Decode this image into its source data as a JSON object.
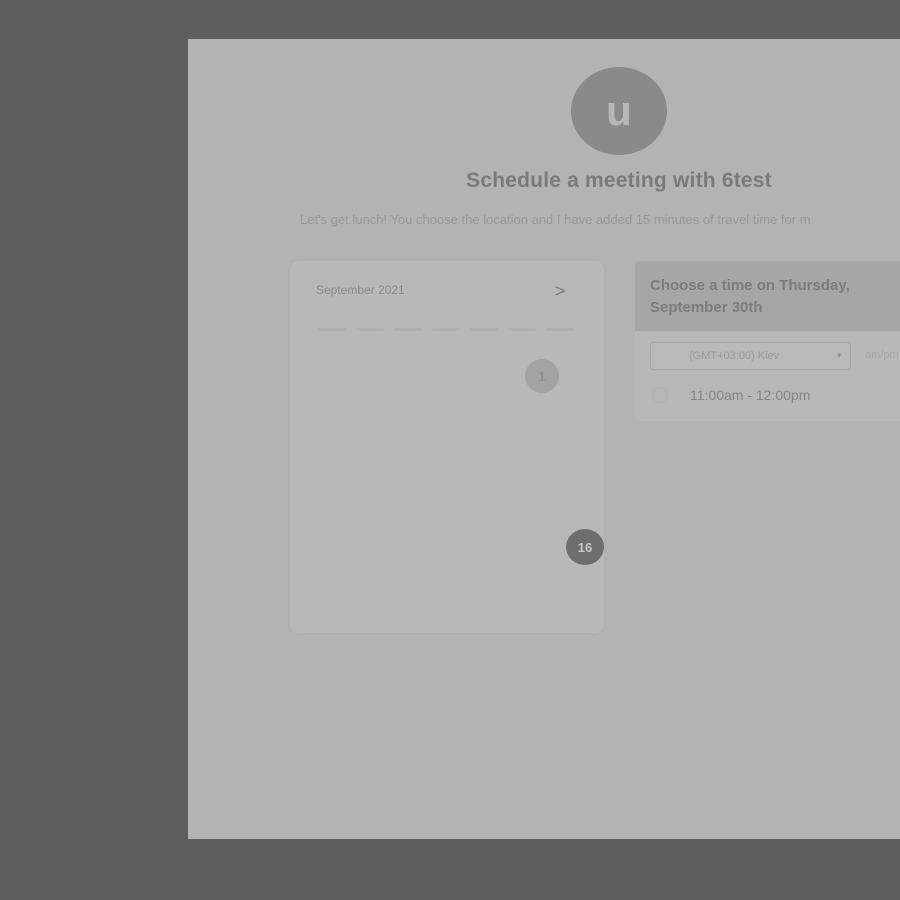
{
  "avatar": {
    "initial": "u"
  },
  "header": {
    "title": "Schedule a meeting with 6test",
    "description": "Let's get lunch! You choose the location and I have added 15 minutes of travel time for m"
  },
  "calendar": {
    "month_label": "September 2021",
    "next_icon": "chevron-right-icon",
    "next_glyph": ">",
    "days": [
      {
        "label": "1"
      },
      {
        "label": "16"
      }
    ]
  },
  "time_panel": {
    "heading": "Choose a time on Thursday, September 30th",
    "timezone": {
      "value": "(GMT+03:00) Kiev",
      "arrow_glyph": "▾"
    },
    "format_label": "am/pm",
    "slots": [
      {
        "label": "11:00am - 12:00pm"
      }
    ]
  }
}
